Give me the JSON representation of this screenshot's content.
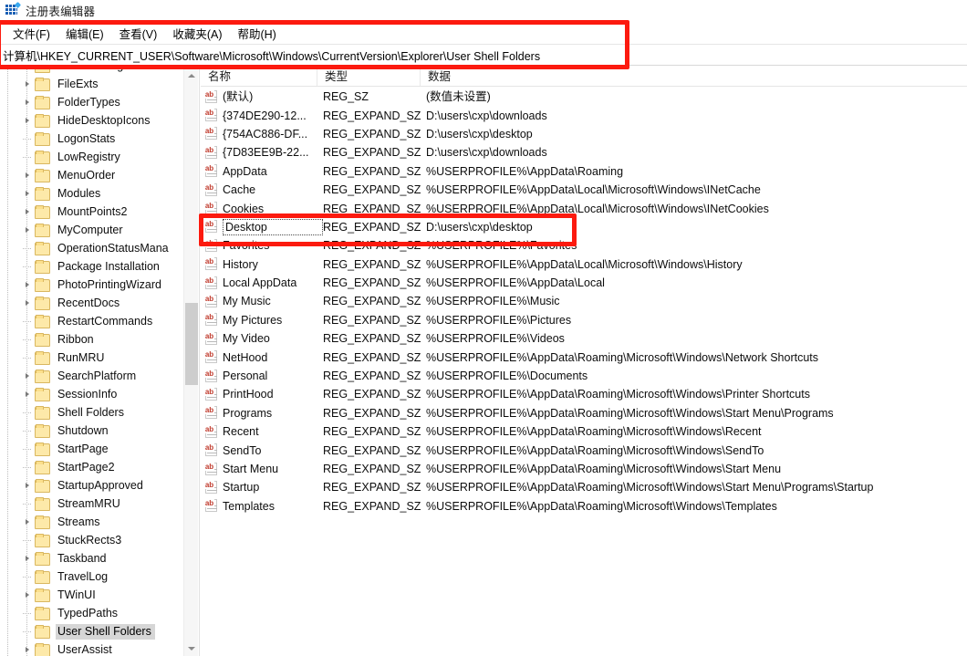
{
  "window": {
    "title": "注册表编辑器",
    "icon": "registry-editor-icon"
  },
  "menubar": {
    "items": [
      {
        "label": "文件(F)",
        "accel": "F",
        "text": "文件(",
        "tail": ")"
      },
      {
        "label": "编辑(E)",
        "accel": "E"
      },
      {
        "label": "查看(V)",
        "accel": "V"
      },
      {
        "label": "收藏夹(A)",
        "accel": "A"
      },
      {
        "label": "帮助(H)",
        "accel": "H"
      }
    ]
  },
  "address": {
    "path": "计算机\\HKEY_CURRENT_USER\\Software\\Microsoft\\Windows\\CurrentVersion\\Explorer\\User Shell Folders"
  },
  "tree": {
    "items": [
      {
        "label": "FeatureUsage",
        "expandable": true,
        "selected": false
      },
      {
        "label": "FileExts",
        "expandable": true,
        "selected": false
      },
      {
        "label": "FolderTypes",
        "expandable": true,
        "selected": false
      },
      {
        "label": "HideDesktopIcons",
        "expandable": true,
        "selected": false
      },
      {
        "label": "LogonStats",
        "expandable": false,
        "selected": false
      },
      {
        "label": "LowRegistry",
        "expandable": false,
        "selected": false
      },
      {
        "label": "MenuOrder",
        "expandable": true,
        "selected": false
      },
      {
        "label": "Modules",
        "expandable": true,
        "selected": false
      },
      {
        "label": "MountPoints2",
        "expandable": true,
        "selected": false
      },
      {
        "label": "MyComputer",
        "expandable": true,
        "selected": false
      },
      {
        "label": "OperationStatusMana",
        "expandable": false,
        "selected": false
      },
      {
        "label": "Package Installation",
        "expandable": false,
        "selected": false
      },
      {
        "label": "PhotoPrintingWizard",
        "expandable": true,
        "selected": false
      },
      {
        "label": "RecentDocs",
        "expandable": true,
        "selected": false
      },
      {
        "label": "RestartCommands",
        "expandable": false,
        "selected": false
      },
      {
        "label": "Ribbon",
        "expandable": false,
        "selected": false
      },
      {
        "label": "RunMRU",
        "expandable": false,
        "selected": false
      },
      {
        "label": "SearchPlatform",
        "expandable": true,
        "selected": false
      },
      {
        "label": "SessionInfo",
        "expandable": true,
        "selected": false
      },
      {
        "label": "Shell Folders",
        "expandable": false,
        "selected": false
      },
      {
        "label": "Shutdown",
        "expandable": false,
        "selected": false
      },
      {
        "label": "StartPage",
        "expandable": false,
        "selected": false
      },
      {
        "label": "StartPage2",
        "expandable": false,
        "selected": false
      },
      {
        "label": "StartupApproved",
        "expandable": true,
        "selected": false
      },
      {
        "label": "StreamMRU",
        "expandable": false,
        "selected": false
      },
      {
        "label": "Streams",
        "expandable": true,
        "selected": false
      },
      {
        "label": "StuckRects3",
        "expandable": false,
        "selected": false
      },
      {
        "label": "Taskband",
        "expandable": true,
        "selected": false
      },
      {
        "label": "TravelLog",
        "expandable": false,
        "selected": false
      },
      {
        "label": "TWinUI",
        "expandable": true,
        "selected": false
      },
      {
        "label": "TypedPaths",
        "expandable": false,
        "selected": false
      },
      {
        "label": "User Shell Folders",
        "expandable": false,
        "selected": true
      },
      {
        "label": "UserAssist",
        "expandable": true,
        "selected": false
      }
    ]
  },
  "list": {
    "columns": [
      "名称",
      "类型",
      "数据"
    ],
    "rows": [
      {
        "name": "(默认)",
        "type": "REG_SZ",
        "data": "(数值未设置)",
        "focused": false
      },
      {
        "name": "{374DE290-12...",
        "type": "REG_EXPAND_SZ",
        "data": "D:\\users\\cxp\\downloads",
        "focused": false
      },
      {
        "name": "{754AC886-DF...",
        "type": "REG_EXPAND_SZ",
        "data": "D:\\users\\cxp\\desktop",
        "focused": false
      },
      {
        "name": "{7D83EE9B-22...",
        "type": "REG_EXPAND_SZ",
        "data": "D:\\users\\cxp\\downloads",
        "focused": false
      },
      {
        "name": "AppData",
        "type": "REG_EXPAND_SZ",
        "data": "%USERPROFILE%\\AppData\\Roaming",
        "focused": false
      },
      {
        "name": "Cache",
        "type": "REG_EXPAND_SZ",
        "data": "%USERPROFILE%\\AppData\\Local\\Microsoft\\Windows\\INetCache",
        "focused": false
      },
      {
        "name": "Cookies",
        "type": "REG_EXPAND_SZ",
        "data": "%USERPROFILE%\\AppData\\Local\\Microsoft\\Windows\\INetCookies",
        "focused": false
      },
      {
        "name": "Desktop",
        "type": "REG_EXPAND_SZ",
        "data": "D:\\users\\cxp\\desktop",
        "focused": true
      },
      {
        "name": "Favorites",
        "type": "REG_EXPAND_SZ",
        "data": "%USERPROFILE%\\Favorites",
        "focused": false
      },
      {
        "name": "History",
        "type": "REG_EXPAND_SZ",
        "data": "%USERPROFILE%\\AppData\\Local\\Microsoft\\Windows\\History",
        "focused": false
      },
      {
        "name": "Local AppData",
        "type": "REG_EXPAND_SZ",
        "data": "%USERPROFILE%\\AppData\\Local",
        "focused": false
      },
      {
        "name": "My Music",
        "type": "REG_EXPAND_SZ",
        "data": "%USERPROFILE%\\Music",
        "focused": false
      },
      {
        "name": "My Pictures",
        "type": "REG_EXPAND_SZ",
        "data": "%USERPROFILE%\\Pictures",
        "focused": false
      },
      {
        "name": "My Video",
        "type": "REG_EXPAND_SZ",
        "data": "%USERPROFILE%\\Videos",
        "focused": false
      },
      {
        "name": "NetHood",
        "type": "REG_EXPAND_SZ",
        "data": "%USERPROFILE%\\AppData\\Roaming\\Microsoft\\Windows\\Network Shortcuts",
        "focused": false
      },
      {
        "name": "Personal",
        "type": "REG_EXPAND_SZ",
        "data": "%USERPROFILE%\\Documents",
        "focused": false
      },
      {
        "name": "PrintHood",
        "type": "REG_EXPAND_SZ",
        "data": "%USERPROFILE%\\AppData\\Roaming\\Microsoft\\Windows\\Printer Shortcuts",
        "focused": false
      },
      {
        "name": "Programs",
        "type": "REG_EXPAND_SZ",
        "data": "%USERPROFILE%\\AppData\\Roaming\\Microsoft\\Windows\\Start Menu\\Programs",
        "focused": false
      },
      {
        "name": "Recent",
        "type": "REG_EXPAND_SZ",
        "data": "%USERPROFILE%\\AppData\\Roaming\\Microsoft\\Windows\\Recent",
        "focused": false
      },
      {
        "name": "SendTo",
        "type": "REG_EXPAND_SZ",
        "data": "%USERPROFILE%\\AppData\\Roaming\\Microsoft\\Windows\\SendTo",
        "focused": false
      },
      {
        "name": "Start Menu",
        "type": "REG_EXPAND_SZ",
        "data": "%USERPROFILE%\\AppData\\Roaming\\Microsoft\\Windows\\Start Menu",
        "focused": false
      },
      {
        "name": "Startup",
        "type": "REG_EXPAND_SZ",
        "data": "%USERPROFILE%\\AppData\\Roaming\\Microsoft\\Windows\\Start Menu\\Programs\\Startup",
        "focused": false
      },
      {
        "name": "Templates",
        "type": "REG_EXPAND_SZ",
        "data": "%USERPROFILE%\\AppData\\Roaming\\Microsoft\\Windows\\Templates",
        "focused": false
      }
    ]
  },
  "annotations": {
    "color": "#fc1a0f",
    "boxes": [
      {
        "id": "menu-and-address-highlight"
      },
      {
        "id": "desktop-row-highlight"
      }
    ]
  }
}
